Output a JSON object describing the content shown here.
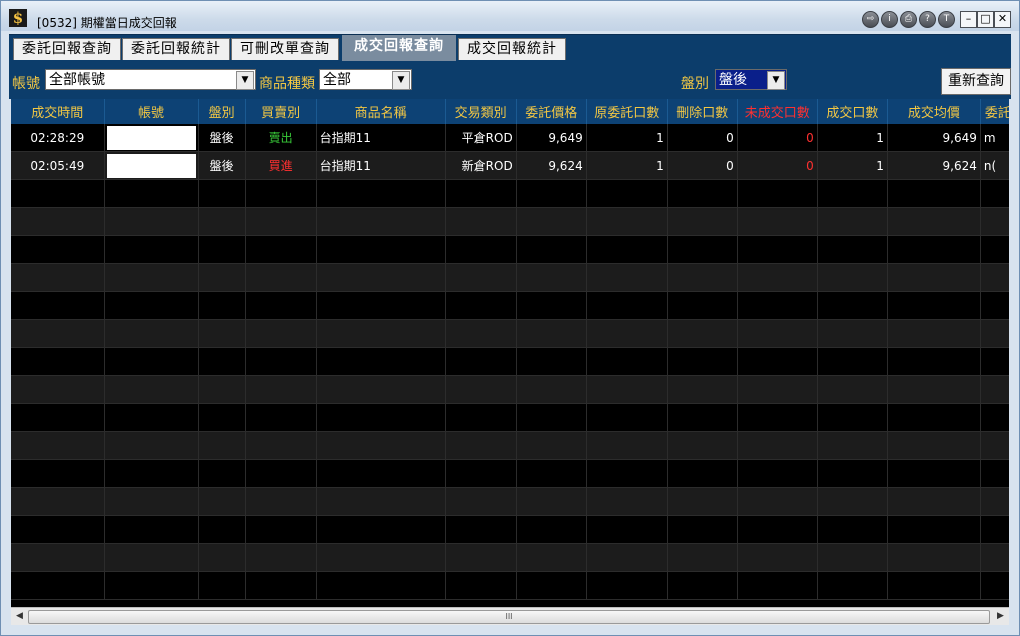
{
  "window": {
    "title": "[0532] 期權當日成交回報"
  },
  "title_buttons": [
    "⇨",
    "i",
    "⎙",
    "?",
    "T"
  ],
  "window_controls": {
    "minimize": "–",
    "maximize": "□",
    "close": "✕"
  },
  "tabs": [
    {
      "label": "委託回報查詢",
      "active": false
    },
    {
      "label": "委託回報統計",
      "active": false
    },
    {
      "label": "可刪改單查詢",
      "active": false
    },
    {
      "label": "成交回報查詢",
      "active": true
    },
    {
      "label": "成交回報統計",
      "active": false
    }
  ],
  "filters": {
    "account_label": "帳號",
    "account_value": "全部帳號",
    "product_type_label": "商品種類",
    "product_type_value": "全部",
    "session_label": "盤別",
    "session_value": "盤後",
    "requery_label": "重新查詢"
  },
  "table": {
    "columns": [
      "成交時間",
      "帳號",
      "盤別",
      "買賣別",
      "商品名稱",
      "交易類別",
      "委託價格",
      "原委託口數",
      "刪除口數",
      "未成交口數",
      "成交口數",
      "成交均價",
      "委託"
    ],
    "rows": [
      {
        "time": "02:28:29",
        "account": "",
        "session": "盤後",
        "side": "賣出",
        "product": "台指期11",
        "trade_type": "平倉ROD",
        "order_price": "9,649",
        "orig_qty": "1",
        "cancel_qty": "0",
        "unfilled_qty": "0",
        "filled_qty": "1",
        "avg_price": "9,649",
        "order_no": "m"
      },
      {
        "time": "02:05:49",
        "account": "",
        "session": "盤後",
        "side": "買進",
        "product": "台指期11",
        "trade_type": "新倉ROD",
        "order_price": "9,624",
        "orig_qty": "1",
        "cancel_qty": "0",
        "unfilled_qty": "0",
        "filled_qty": "1",
        "avg_price": "9,624",
        "order_no": "n("
      }
    ]
  },
  "scrollbar": {
    "grip": "III"
  },
  "colors": {
    "header_bg": "#0d4275",
    "header_text": "#f2c744",
    "sell": "#38c838",
    "buy": "#ff3030",
    "unfilled": "#ff3030"
  }
}
